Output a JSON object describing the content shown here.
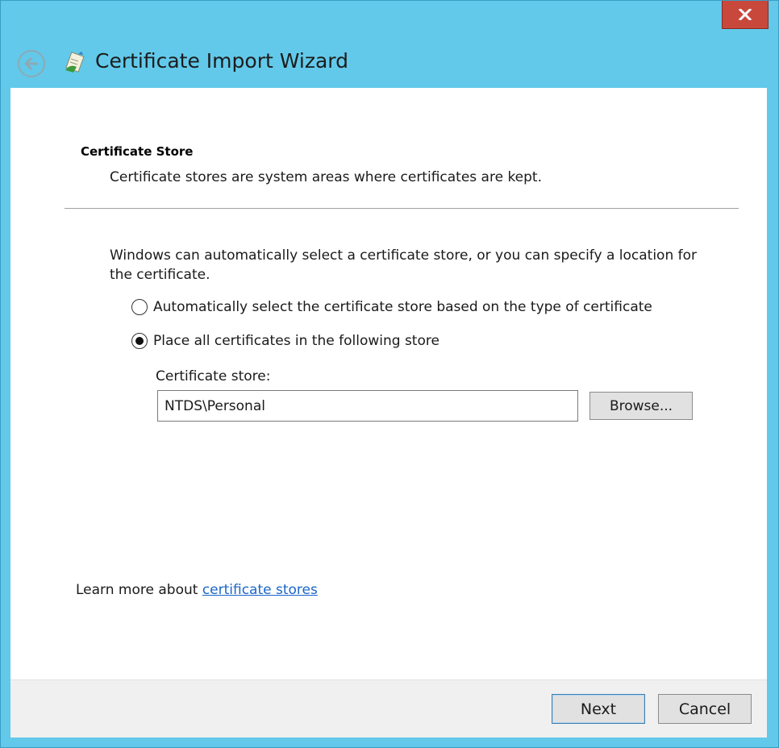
{
  "window": {
    "title": "Certificate Import Wizard"
  },
  "page": {
    "section_header": "Certificate Store",
    "section_description": "Certificate stores are system areas where certificates are kept.",
    "intro": "Windows can automatically select a certificate store, or you can specify a location for the certificate.",
    "options": [
      {
        "label": "Automatically select the certificate store based on the type of certificate",
        "selected": false
      },
      {
        "label": "Place all certificates in the following store",
        "selected": true
      }
    ],
    "store_label": "Certificate store:",
    "store_value": "NTDS\\Personal",
    "browse_label": "Browse...",
    "learn_more_prefix": "Learn more about ",
    "learn_more_link": "certificate stores"
  },
  "footer": {
    "next_label": "Next",
    "cancel_label": "Cancel"
  },
  "colors": {
    "titlebar": "#62c9ea",
    "close_button": "#c9483c",
    "link": "#1a66c9"
  }
}
